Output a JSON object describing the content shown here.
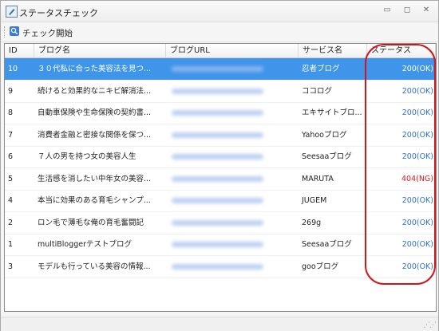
{
  "window": {
    "title": "ステータスチェック"
  },
  "toolbar": {
    "check_label": "チェック開始"
  },
  "grid": {
    "columns": {
      "id": "ID",
      "name": "ブログ名",
      "url": "ブログURL",
      "service": "サービス名",
      "status": "ステータス"
    },
    "rows": [
      {
        "id": "10",
        "name": "３０代私に合った美容法を見つ...",
        "service": "忍者ブログ",
        "status": "200(OK)",
        "state": "ok",
        "selected": true
      },
      {
        "id": "9",
        "name": "続けると効果的なニキビ解消法...",
        "service": "ココログ",
        "status": "200(OK)",
        "state": "ok"
      },
      {
        "id": "8",
        "name": "自動車保険や生命保険の契約書...",
        "service": "エキサイトブロ...",
        "status": "200(OK)",
        "state": "ok"
      },
      {
        "id": "7",
        "name": "消費者金融と密接な関係を保つ...",
        "service": "Yahooブログ",
        "status": "200(OK)",
        "state": "ok"
      },
      {
        "id": "6",
        "name": "７人の男を持つ女の美容人生",
        "service": "Seesaaブログ",
        "status": "200(OK)",
        "state": "ok"
      },
      {
        "id": "5",
        "name": "生活感を消したい中年女の美容...",
        "service": "MARUTA",
        "status": "404(NG)",
        "state": "ng"
      },
      {
        "id": "4",
        "name": "本当に効果のある育毛シャンプ...",
        "service": "JUGEM",
        "status": "200(OK)",
        "state": "ok"
      },
      {
        "id": "2",
        "name": "ロン毛で薄毛な俺の育毛奮闘記",
        "service": "269g",
        "status": "200(OK)",
        "state": "ok"
      },
      {
        "id": "1",
        "name": "multiBloggerテストブログ",
        "service": "Seesaaブログ",
        "status": "200(OK)",
        "state": "ok"
      },
      {
        "id": "3",
        "name": "モデルも行っている美容の情報...",
        "service": "gooブログ",
        "status": "200(OK)",
        "state": "ok"
      }
    ]
  },
  "colors": {
    "selected_row": "#3f95ea",
    "status_ok": "#2f6fc4",
    "status_ng": "#d12020",
    "annotation": "#d0161d"
  }
}
